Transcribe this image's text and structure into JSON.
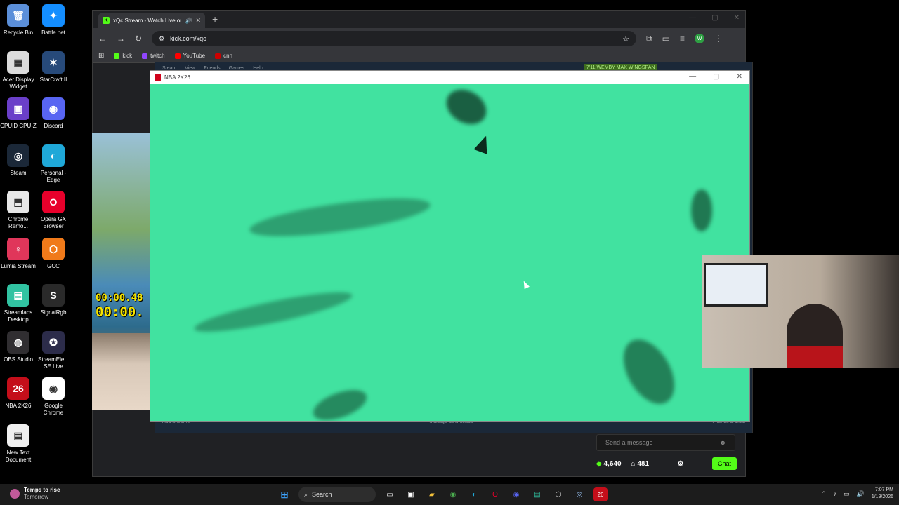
{
  "desktop_icons": [
    {
      "label": "Recycle Bin",
      "color": "#5b8fd9",
      "glyph": "🗑"
    },
    {
      "label": "Battle.net",
      "color": "#148eff",
      "glyph": "✦"
    },
    {
      "label": "Acer Display Widget",
      "color": "#dcdcdc",
      "glyph": "▦"
    },
    {
      "label": "StarCraft II",
      "color": "#274a7a",
      "glyph": "✶"
    },
    {
      "label": "CPUID CPU-Z",
      "color": "#6a3fc9",
      "glyph": "▣"
    },
    {
      "label": "Discord",
      "color": "#5865f2",
      "glyph": "◉"
    },
    {
      "label": "Steam",
      "color": "#1b2838",
      "glyph": "◎"
    },
    {
      "label": "Personal - Edge",
      "color": "#1fa8d8",
      "glyph": "◐"
    },
    {
      "label": "Chrome Remo...",
      "color": "#e8e8e8",
      "glyph": "⬒"
    },
    {
      "label": "Opera GX Browser",
      "color": "#e8002b",
      "glyph": "O"
    },
    {
      "label": "Lumia Stream",
      "color": "#e0365a",
      "glyph": "♀"
    },
    {
      "label": "GCC",
      "color": "#f07a1a",
      "glyph": "⬡"
    },
    {
      "label": "Streamlabs Desktop",
      "color": "#31c3a2",
      "glyph": "▤"
    },
    {
      "label": "SignalRgb",
      "color": "#2a2a2a",
      "glyph": "S"
    },
    {
      "label": "OBS Studio",
      "color": "#302e31",
      "glyph": "◍"
    },
    {
      "label": "StreamEle... SE.Live",
      "color": "#2c2c4a",
      "glyph": "✪"
    },
    {
      "label": "NBA 2K26",
      "color": "#c40e1a",
      "glyph": "26"
    },
    {
      "label": "Google Chrome",
      "color": "#ffffff",
      "glyph": "◉"
    },
    {
      "label": "New Text Document",
      "color": "#f0f0f0",
      "glyph": "▤"
    }
  ],
  "browser": {
    "tab_title": "xQc Stream - Watch Live on",
    "tab_favicon": "K",
    "url": "kick.com/xqc",
    "profile_initial": "W",
    "bookmarks": [
      {
        "label": "kick",
        "color": "#53fc18"
      },
      {
        "label": "twitch",
        "color": "#9146ff"
      },
      {
        "label": "YouTube",
        "color": "#ff0000"
      },
      {
        "label": "cnn",
        "color": "#cc0000"
      }
    ]
  },
  "stream_overlay": {
    "timer_top": "00:00.48",
    "timer_bottom": "00:00."
  },
  "steam": {
    "menu": [
      "Steam",
      "View",
      "Friends",
      "Games",
      "Help"
    ],
    "user_label": "7'11 WEMBY MAX WINGSPAN",
    "footer_left": "Add a Game",
    "footer_center": "Manage Downloads",
    "footer_right": "Friends & Chat"
  },
  "game_window": {
    "title": "NBA 2K26",
    "background_color": "#41e2a0"
  },
  "chat": {
    "placeholder": "Send a message",
    "points": "4,640",
    "gifts": "481",
    "chat_button": "Chat"
  },
  "taskbar": {
    "weather_line1": "Temps to rise",
    "weather_line2": "Tomorrow",
    "search_label": "Search",
    "time": "7:07 PM",
    "date": "1/19/2026"
  }
}
